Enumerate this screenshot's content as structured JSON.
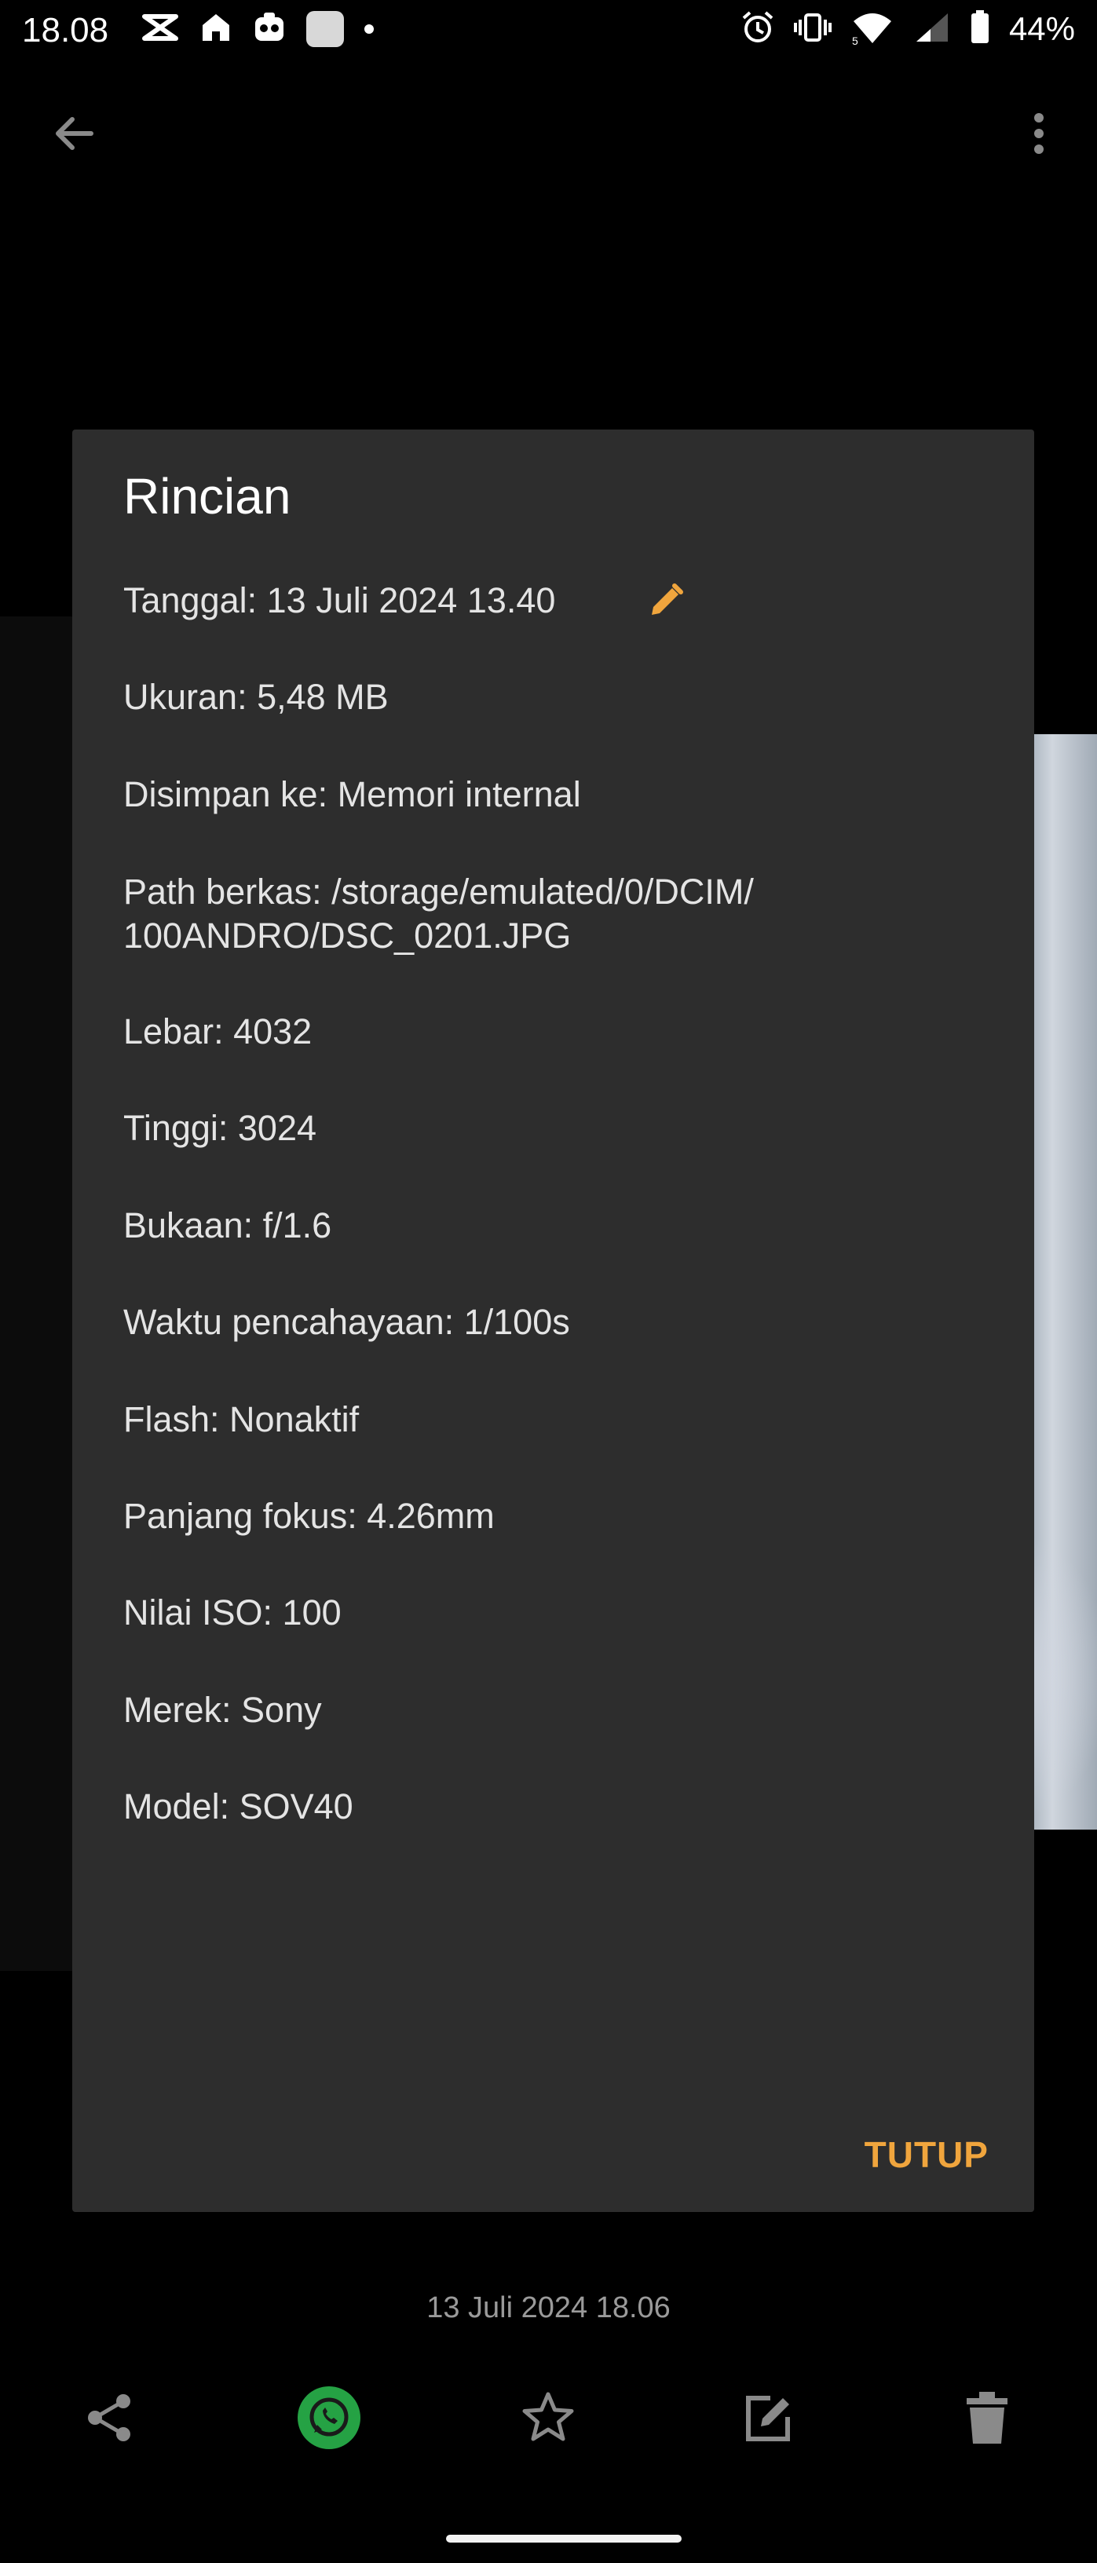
{
  "status_bar": {
    "time": "18.08",
    "battery": "44%",
    "left_icons": [
      "capcut-icon",
      "home-icon",
      "tiktok-icon",
      "app-square-icon",
      "notification-dot-icon"
    ],
    "right_icons": [
      "alarm-icon",
      "vibrate-icon",
      "wifi-icon",
      "signal-icon",
      "battery-icon"
    ]
  },
  "app_bar": {
    "back_icon": "arrow-back-icon",
    "menu_icon": "more-vert-icon"
  },
  "dialog": {
    "title": "Rincian",
    "details": [
      "Tanggal: 13 Juli 2024 13.40",
      "Ukuran: 5,48 MB",
      "Disimpan ke: Memori internal",
      "Path berkas: /storage/emulated/0/DCIM/ 100ANDRO/DSC_0201.JPG",
      "Lebar: 4032",
      "Tinggi: 3024",
      "Bukaan: f/1.6",
      "Waktu pencahayaan: 1/100s",
      "Flash: Nonaktif",
      "Panjang fokus: 4.26mm",
      "Nilai ISO: 100",
      "Merek: Sony",
      "Model: SOV40"
    ],
    "path_line1": "Path berkas: /storage/emulated/0/DCIM/",
    "path_line2": "100ANDRO/DSC_0201.JPG",
    "edit_icon": "pencil-icon",
    "close_label": "TUTUP"
  },
  "photo_date": "13 Juli 2024 18.06",
  "actions": [
    "share-icon",
    "whatsapp-icon",
    "star-icon",
    "edit-icon",
    "delete-icon"
  ],
  "colors": {
    "accent": "#f0a53d",
    "dialog_bg": "#2d2d2d",
    "whatsapp": "#25a244"
  }
}
